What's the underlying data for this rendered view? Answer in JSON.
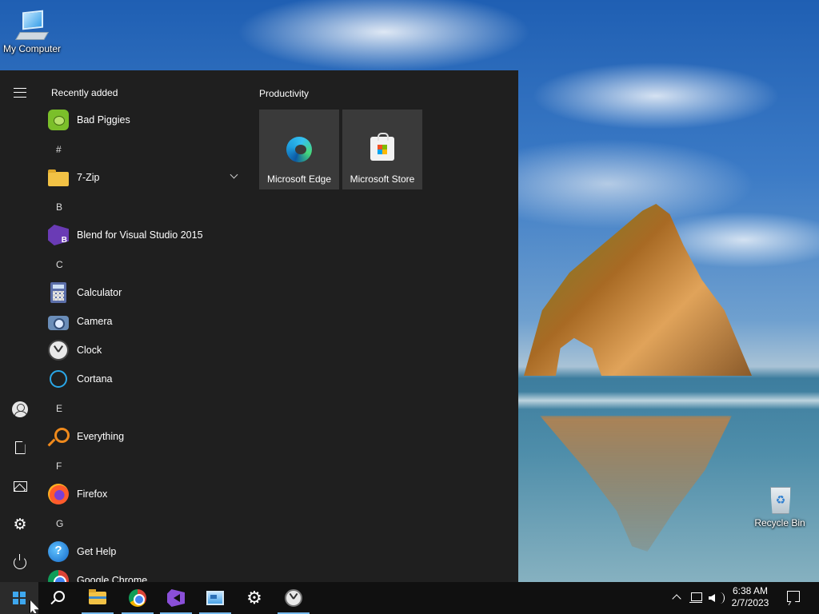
{
  "desktop": {
    "icons": [
      {
        "label": "My Computer",
        "icon": "computer-icon"
      },
      {
        "label": "Recycle Bin",
        "icon": "recycle-bin-icon"
      }
    ]
  },
  "start_menu": {
    "rail": [
      "hamburger-icon",
      "user-avatar-icon",
      "documents-icon",
      "pictures-icon",
      "settings-icon",
      "power-icon"
    ],
    "recently_added_title": "Recently added",
    "apps": [
      {
        "type": "app",
        "label": "Bad Piggies",
        "icon": "bad-piggies-icon"
      },
      {
        "type": "letter",
        "label": "#"
      },
      {
        "type": "app",
        "label": "7-Zip",
        "icon": "folder-icon",
        "expandable": true
      },
      {
        "type": "letter",
        "label": "B"
      },
      {
        "type": "app",
        "label": "Blend for Visual Studio 2015",
        "icon": "blend-icon"
      },
      {
        "type": "letter",
        "label": "C"
      },
      {
        "type": "app",
        "label": "Calculator",
        "icon": "calculator-icon"
      },
      {
        "type": "app",
        "label": "Camera",
        "icon": "camera-icon"
      },
      {
        "type": "app",
        "label": "Clock",
        "icon": "clock-icon"
      },
      {
        "type": "app",
        "label": "Cortana",
        "icon": "cortana-icon"
      },
      {
        "type": "letter",
        "label": "E"
      },
      {
        "type": "app",
        "label": "Everything",
        "icon": "search-magnifier-icon"
      },
      {
        "type": "letter",
        "label": "F"
      },
      {
        "type": "app",
        "label": "Firefox",
        "icon": "firefox-icon"
      },
      {
        "type": "letter",
        "label": "G"
      },
      {
        "type": "app",
        "label": "Get Help",
        "icon": "help-icon"
      },
      {
        "type": "app",
        "label": "Google Chrome",
        "icon": "chrome-icon"
      }
    ],
    "tiles_group_title": "Productivity",
    "tiles": [
      {
        "label": "Microsoft Edge",
        "icon": "edge-icon"
      },
      {
        "label": "Microsoft Store",
        "icon": "store-icon"
      }
    ]
  },
  "taskbar": {
    "items": [
      "windows-start-icon",
      "search-icon",
      "file-explorer-icon",
      "chrome-icon",
      "visual-studio-icon",
      "remote-desktop-icon",
      "settings-icon",
      "clock-icon"
    ],
    "tray": {
      "time": "6:38 AM",
      "date": "2/7/2023"
    }
  },
  "colors": {
    "start_bg": "#1f1f1f",
    "tile_bg": "#3a3a3a",
    "taskbar_bg": "#101010",
    "accent": "#76b9ed"
  }
}
